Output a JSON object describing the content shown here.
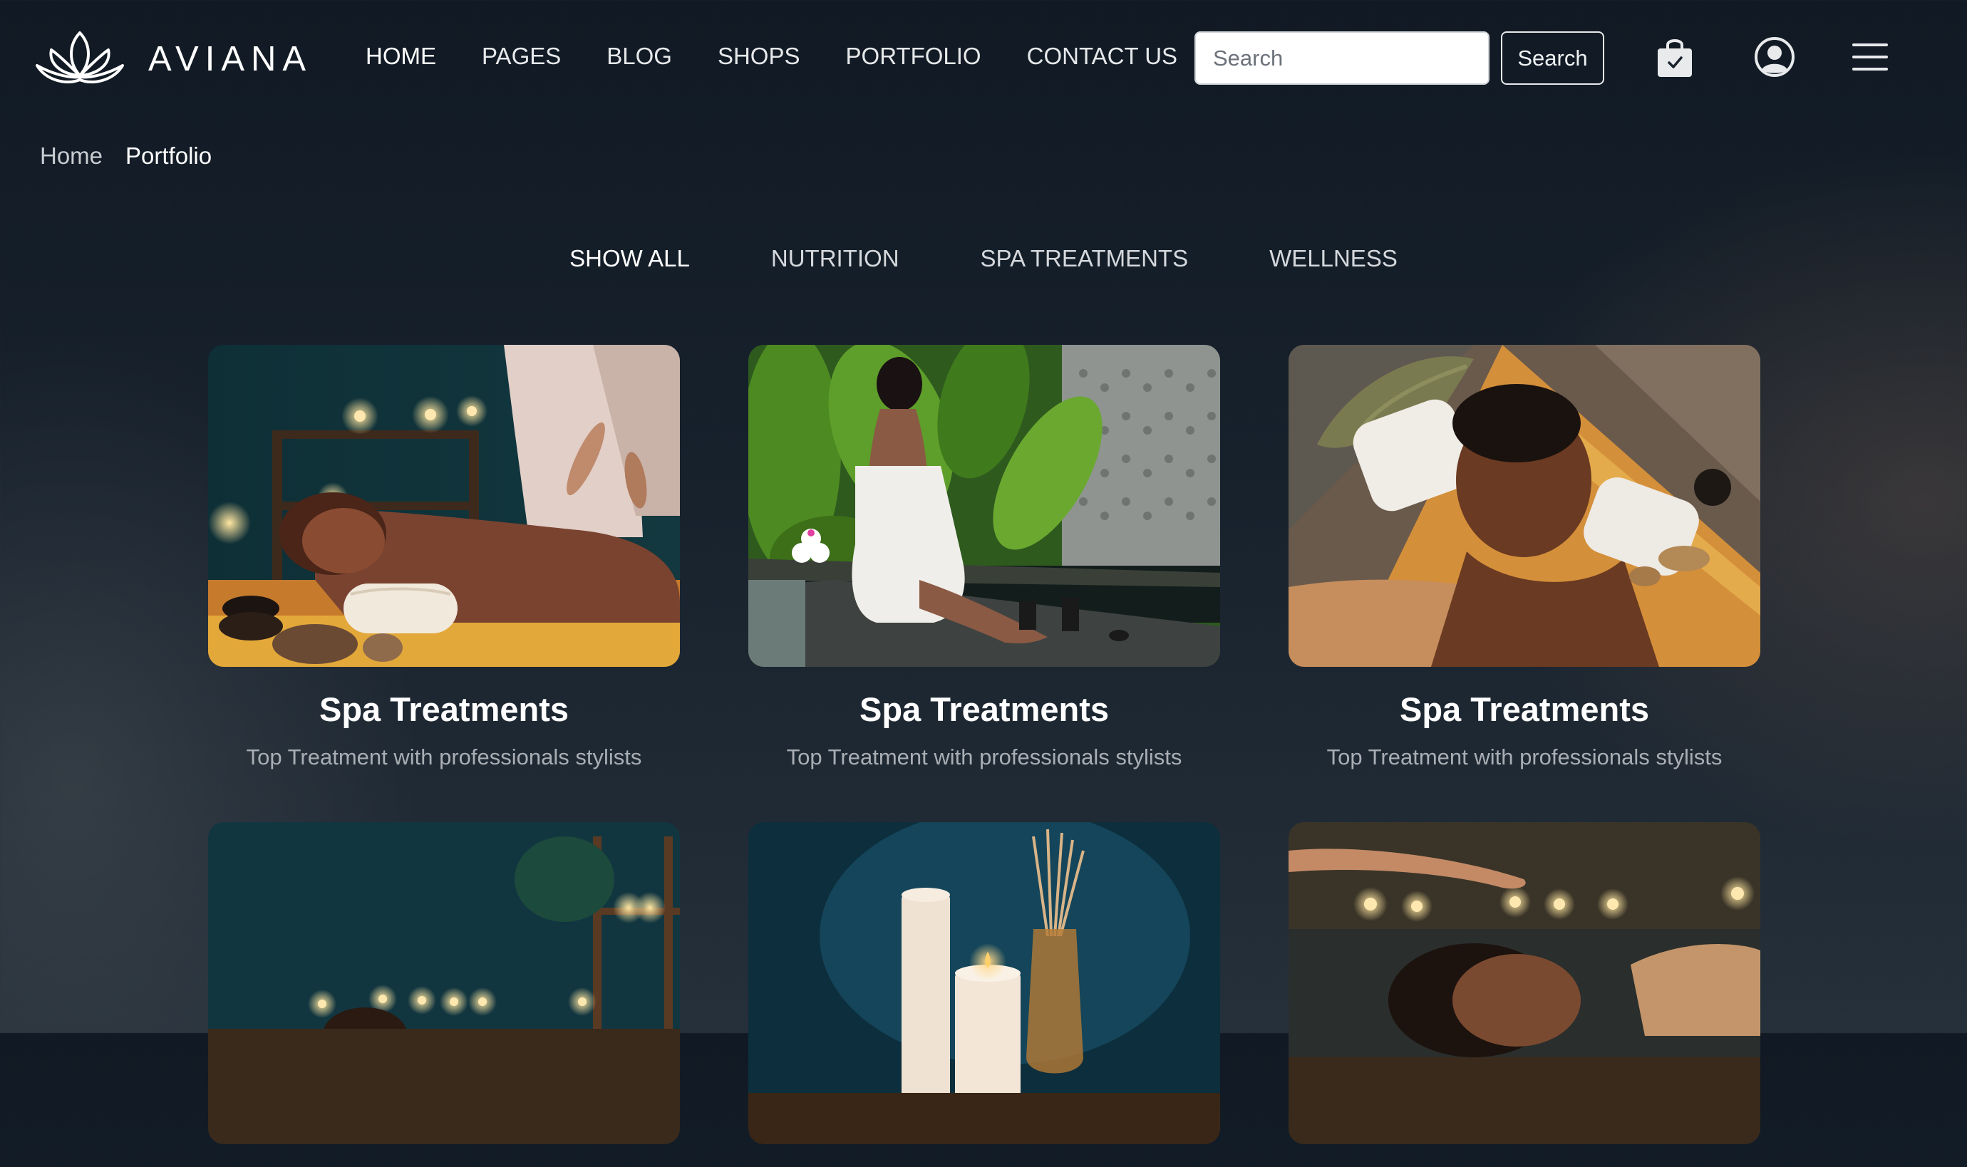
{
  "brand": {
    "name": "AVIANA",
    "logo_icon": "lotus-icon"
  },
  "nav": {
    "items": [
      {
        "label": "HOME",
        "active": true
      },
      {
        "label": "PAGES",
        "active": false
      },
      {
        "label": "BLOG",
        "active": false
      },
      {
        "label": "SHOPS",
        "active": false
      },
      {
        "label": "PORTFOLIO",
        "active": false
      },
      {
        "label": "CONTACT US",
        "active": false
      }
    ]
  },
  "search": {
    "placeholder": "Search",
    "button_label": "Search"
  },
  "header_icons": [
    "shopping-bag-icon",
    "user-account-icon",
    "hamburger-menu-icon"
  ],
  "breadcrumb": {
    "home": "Home",
    "current": "Portfolio"
  },
  "filters": [
    {
      "label": "SHOW ALL",
      "active": true
    },
    {
      "label": "NUTRITION",
      "active": false
    },
    {
      "label": "SPA TREATMENTS",
      "active": false
    },
    {
      "label": "WELLNESS",
      "active": false
    }
  ],
  "portfolio": {
    "items": [
      {
        "title": "Spa Treatments",
        "subtitle": "Top Treatment with professionals stylists"
      },
      {
        "title": "Spa Treatments",
        "subtitle": "Top Treatment with professionals stylists"
      },
      {
        "title": "Spa Treatments",
        "subtitle": "Top Treatment with professionals stylists"
      },
      {
        "title": "",
        "subtitle": ""
      },
      {
        "title": "",
        "subtitle": ""
      },
      {
        "title": "",
        "subtitle": ""
      }
    ]
  },
  "colors": {
    "background": "#17212c",
    "text": "#ffffff",
    "muted_text": "#a9aeb4",
    "search_bg": "#ffffff"
  }
}
